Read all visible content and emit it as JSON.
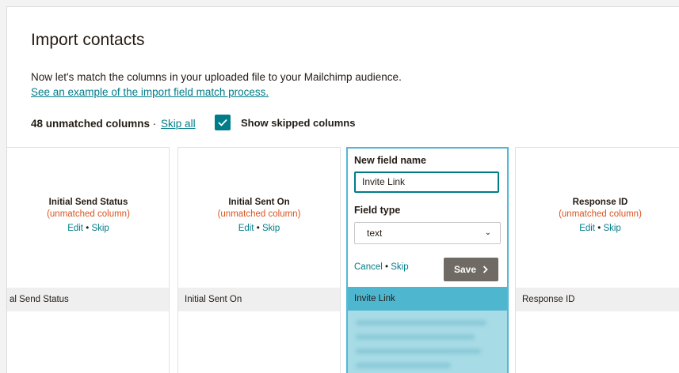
{
  "page": {
    "title": "Import contacts",
    "intro": "Now let's match the columns in your uploaded file to your Mailchimp audience.",
    "example_link": "See an example of the import field match process.",
    "unmatched_count": "48 unmatched columns",
    "summary_sep": " · ",
    "skip_all": "Skip all",
    "show_skipped_label": "Show skipped columns",
    "show_skipped_checked": true
  },
  "columns": [
    {
      "name": "Initial Send Status",
      "status": "(unmatched column)",
      "edit": "Edit",
      "dot": " • ",
      "skip": "Skip",
      "row": "al Send Status"
    },
    {
      "name": "Initial Sent On",
      "status": "(unmatched column)",
      "edit": "Edit",
      "dot": " • ",
      "skip": "Skip",
      "row": "Initial Sent On"
    },
    {
      "name": "Response ID",
      "status": "(unmatched column)",
      "edit": "Edit",
      "dot": " • ",
      "skip": "Skip",
      "row": "Response ID"
    }
  ],
  "editor": {
    "new_field_label": "New field name",
    "new_field_value": "Invite Link",
    "field_type_label": "Field type",
    "field_type_value": "text",
    "cancel": "Cancel",
    "dot": " • ",
    "skip": "Skip",
    "save": "Save",
    "row": "Invite Link"
  },
  "colors": {
    "accent": "#007c89",
    "unmatched": "#d9531e",
    "highlight": "#4fb6d0",
    "save_bg": "#706a65"
  }
}
